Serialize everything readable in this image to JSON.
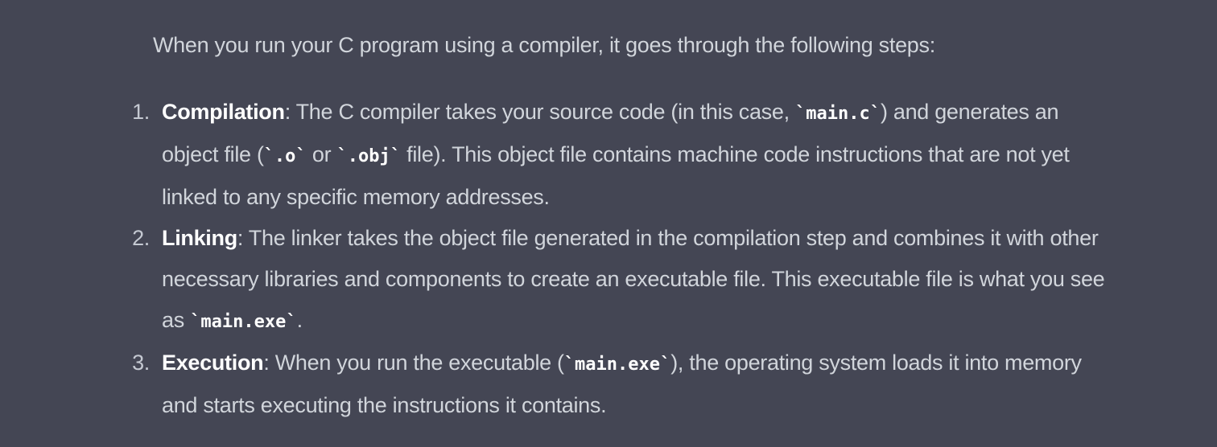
{
  "intro": "When you run your C program using a compiler, it goes through the following steps:",
  "steps": [
    {
      "number": "1.",
      "title": "Compilation",
      "text_a": ": The C compiler takes your source code (in this case, ",
      "code_a": "`main.c`",
      "text_b": ") and generates an object file (",
      "code_b": "`.o`",
      "text_c": " or ",
      "code_c": "`.obj`",
      "text_d": " file). This object file contains machine code instructions that are not yet linked to any specific memory addresses."
    },
    {
      "number": "2.",
      "title": "Linking",
      "text_a": ": The linker takes the object file generated in the compilation step and combines it with other necessary libraries and components to create an executable file. This executable file is what you see as ",
      "code_a": "`main.exe`",
      "text_b": "."
    },
    {
      "number": "3.",
      "title": "Execution",
      "text_a": ": When you run the executable (",
      "code_a": "`main.exe`",
      "text_b": "), the operating system loads it into memory and starts executing the instructions it contains."
    }
  ]
}
